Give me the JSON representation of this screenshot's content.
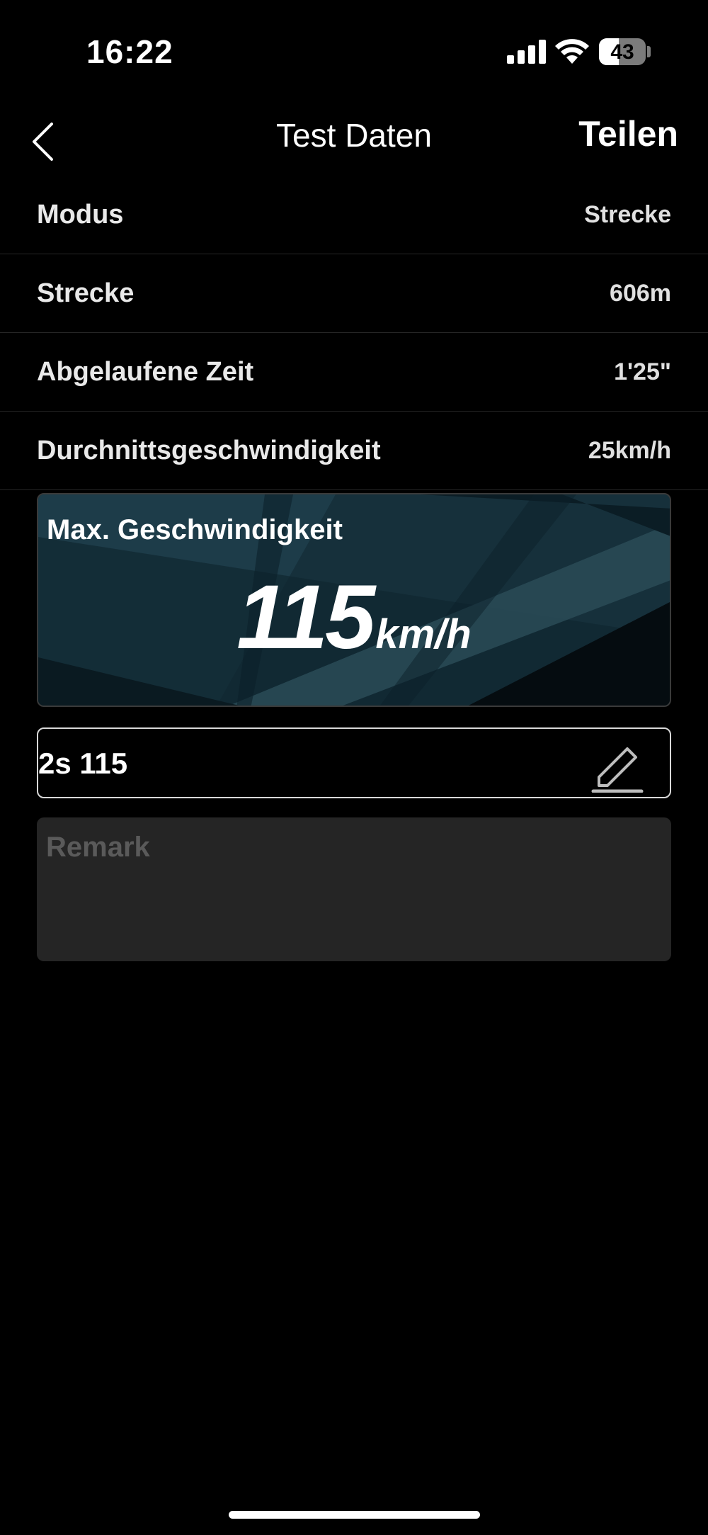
{
  "status_bar": {
    "time": "16:22",
    "battery_level": "43",
    "battery_fraction": 0.43,
    "icons": [
      "cellular-signal-icon",
      "wifi-icon",
      "battery-icon"
    ]
  },
  "nav": {
    "title": "Test Daten",
    "share_label": "Teilen",
    "back_icon": "chevron-left-icon"
  },
  "info_rows": [
    {
      "label": "Modus",
      "value": "Strecke"
    },
    {
      "label": "Strecke",
      "value": "606m"
    },
    {
      "label": "Abgelaufene Zeit",
      "value": "1'25\""
    },
    {
      "label": "Durchnittsgeschwindigkeit",
      "value": "25km/h"
    }
  ],
  "max_speed": {
    "label": "Max. Geschwindigkeit",
    "value": "115",
    "unit": "km/h"
  },
  "record": {
    "title": "2s 115",
    "edit_icon": "pencil-icon",
    "remark_placeholder": "Remark",
    "remark_value": ""
  },
  "colors": {
    "background": "#000000",
    "card_background": "#17303b",
    "remark_background": "#252525",
    "divider": "#262626"
  }
}
